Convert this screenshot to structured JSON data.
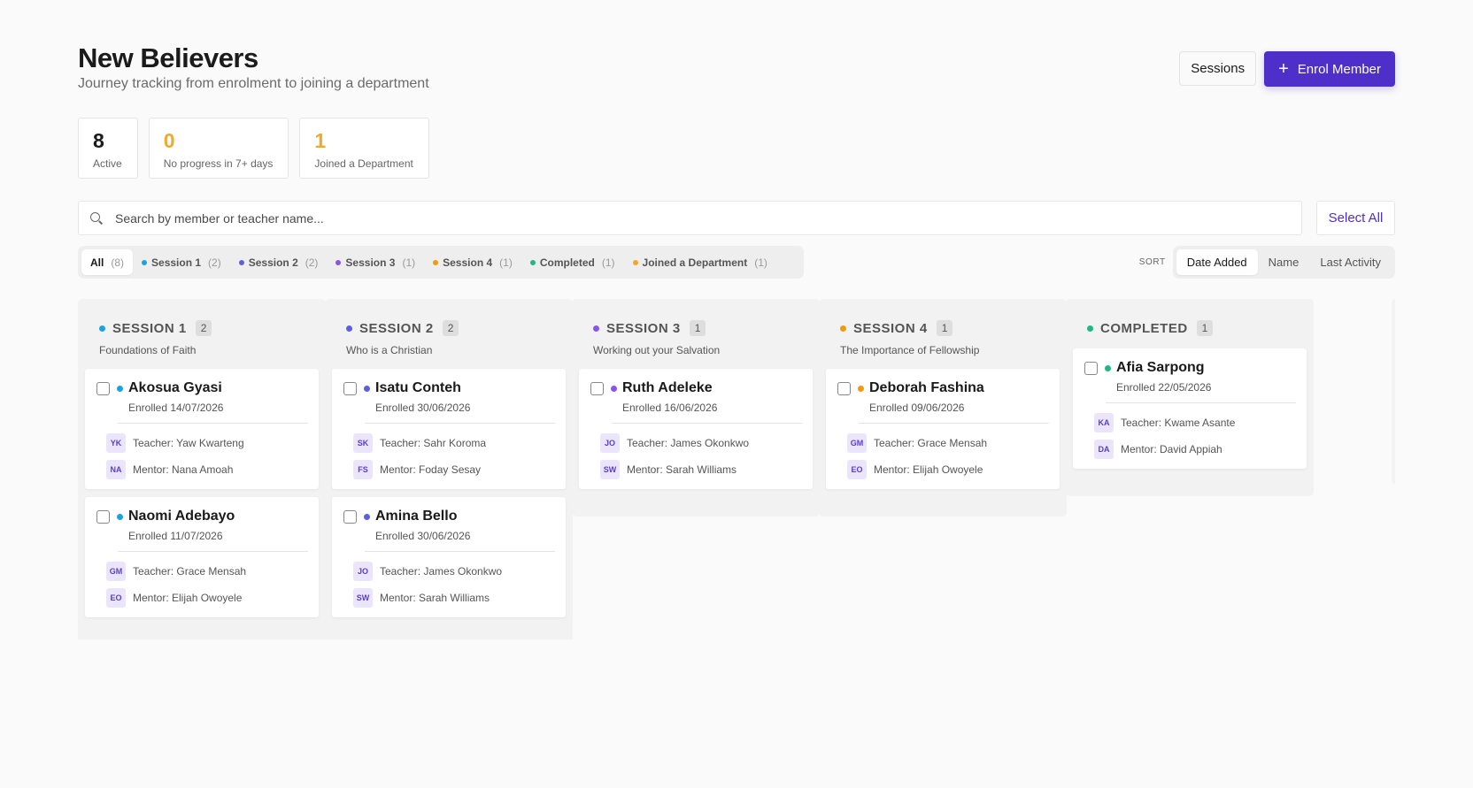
{
  "header": {
    "title": "New Believers",
    "subtitle": "Journey tracking from enrolment to joining a department",
    "sessions_label": "Sessions",
    "enrol_label": "Enrol Member",
    "enrol_icon": "+"
  },
  "stats": [
    {
      "value": "8",
      "label": "Active",
      "color": "#1b1b1b"
    },
    {
      "value": "0",
      "label": "No progress in 7+ days",
      "color": "#f0a92e"
    },
    {
      "value": "1",
      "label": "Joined a Department",
      "color": "#f0a92e"
    }
  ],
  "search": {
    "placeholder": "Search by member or teacher name...",
    "select_all_label": "Select All"
  },
  "filters": [
    {
      "label": "All",
      "count": "(8)",
      "color": null,
      "active": true
    },
    {
      "label": "Session 1",
      "count": "(2)",
      "color": "#1ca3dc"
    },
    {
      "label": "Session 2",
      "count": "(2)",
      "color": "#5b5fe0"
    },
    {
      "label": "Session 3",
      "count": "(1)",
      "color": "#8a55e6"
    },
    {
      "label": "Session 4",
      "count": "(1)",
      "color": "#f09a0e"
    },
    {
      "label": "Completed",
      "count": "(1)",
      "color": "#1fb883"
    },
    {
      "label": "Joined a Department",
      "count": "(1)",
      "color": "#f5a623"
    }
  ],
  "sort": {
    "label": "SORT",
    "options": [
      "Date Added",
      "Name",
      "Last Activity"
    ],
    "active": "Date Added"
  },
  "columns": [
    {
      "title": "SESSION 1",
      "count": "2",
      "subtitle": "Foundations of Faith",
      "color": "#1ca3dc",
      "cards": [
        {
          "name": "Akosua Gyasi",
          "enrolled": "Enrolled 14/07/2026",
          "teacher_initials": "YK",
          "teacher": "Teacher: Yaw Kwarteng",
          "mentor_initials": "NA",
          "mentor": "Mentor: Nana Amoah"
        },
        {
          "name": "Naomi Adebayo",
          "enrolled": "Enrolled 11/07/2026",
          "teacher_initials": "GM",
          "teacher": "Teacher: Grace Mensah",
          "mentor_initials": "EO",
          "mentor": "Mentor: Elijah Owoyele"
        }
      ]
    },
    {
      "title": "SESSION 2",
      "count": "2",
      "subtitle": "Who is a Christian",
      "color": "#5b5fe0",
      "cards": [
        {
          "name": "Isatu Conteh",
          "enrolled": "Enrolled 30/06/2026",
          "teacher_initials": "SK",
          "teacher": "Teacher: Sahr Koroma",
          "mentor_initials": "FS",
          "mentor": "Mentor: Foday Sesay"
        },
        {
          "name": "Amina Bello",
          "enrolled": "Enrolled 30/06/2026",
          "teacher_initials": "JO",
          "teacher": "Teacher: James Okonkwo",
          "mentor_initials": "SW",
          "mentor": "Mentor: Sarah Williams"
        }
      ]
    },
    {
      "title": "SESSION 3",
      "count": "1",
      "subtitle": "Working out your Salvation",
      "color": "#8a55e6",
      "cards": [
        {
          "name": "Ruth Adeleke",
          "enrolled": "Enrolled 16/06/2026",
          "teacher_initials": "JO",
          "teacher": "Teacher: James Okonkwo",
          "mentor_initials": "SW",
          "mentor": "Mentor: Sarah Williams"
        }
      ]
    },
    {
      "title": "SESSION 4",
      "count": "1",
      "subtitle": "The Importance of Fellowship",
      "color": "#f09a0e",
      "cards": [
        {
          "name": "Deborah Fashina",
          "enrolled": "Enrolled 09/06/2026",
          "teacher_initials": "GM",
          "teacher": "Teacher: Grace Mensah",
          "mentor_initials": "EO",
          "mentor": "Mentor: Elijah Owoyele"
        }
      ]
    },
    {
      "title": "COMPLETED",
      "count": "1",
      "subtitle": "",
      "color": "#1fb883",
      "cards": [
        {
          "name": "Afia Sarpong",
          "enrolled": "Enrolled 22/05/2026",
          "teacher_initials": "KA",
          "teacher": "Teacher: Kwame Asante",
          "mentor_initials": "DA",
          "mentor": "Mentor: David Appiah"
        }
      ]
    }
  ]
}
